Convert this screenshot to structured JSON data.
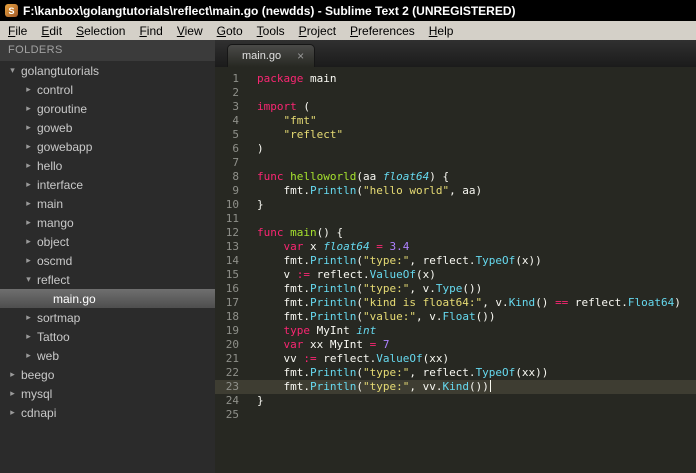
{
  "title_bar": {
    "title": "F:\\kanbox\\golangtutorials\\reflect\\main.go (newdds) - Sublime Text 2 (UNREGISTERED)",
    "app_icon_letter": "S"
  },
  "menu": {
    "items": [
      "File",
      "Edit",
      "Selection",
      "Find",
      "View",
      "Goto",
      "Tools",
      "Project",
      "Preferences",
      "Help"
    ]
  },
  "sidebar": {
    "header": "FOLDERS",
    "items": [
      {
        "label": "golangtutorials",
        "depth": 0,
        "kind": "folder",
        "expanded": true
      },
      {
        "label": "control",
        "depth": 1,
        "kind": "folder",
        "expanded": false
      },
      {
        "label": "goroutine",
        "depth": 1,
        "kind": "folder",
        "expanded": false
      },
      {
        "label": "goweb",
        "depth": 1,
        "kind": "folder",
        "expanded": false
      },
      {
        "label": "gowebapp",
        "depth": 1,
        "kind": "folder",
        "expanded": false
      },
      {
        "label": "hello",
        "depth": 1,
        "kind": "folder",
        "expanded": false
      },
      {
        "label": "interface",
        "depth": 1,
        "kind": "folder",
        "expanded": false
      },
      {
        "label": "main",
        "depth": 1,
        "kind": "folder",
        "expanded": false
      },
      {
        "label": "mango",
        "depth": 1,
        "kind": "folder",
        "expanded": false
      },
      {
        "label": "object",
        "depth": 1,
        "kind": "folder",
        "expanded": false
      },
      {
        "label": "oscmd",
        "depth": 1,
        "kind": "folder",
        "expanded": false
      },
      {
        "label": "reflect",
        "depth": 1,
        "kind": "folder",
        "expanded": true
      },
      {
        "label": "main.go",
        "depth": 2,
        "kind": "file",
        "selected": true
      },
      {
        "label": "sortmap",
        "depth": 1,
        "kind": "folder",
        "expanded": false
      },
      {
        "label": "Tattoo",
        "depth": 1,
        "kind": "folder",
        "expanded": false
      },
      {
        "label": "web",
        "depth": 1,
        "kind": "folder",
        "expanded": false
      },
      {
        "label": "beego",
        "depth": 0,
        "kind": "folder",
        "expanded": false
      },
      {
        "label": "mysql",
        "depth": 0,
        "kind": "folder",
        "expanded": false
      },
      {
        "label": "cdnapi",
        "depth": 0,
        "kind": "folder",
        "expanded": false
      }
    ]
  },
  "tab": {
    "label": "main.go",
    "close_glyph": "×"
  },
  "colors": {
    "editor_background": "#272822",
    "current_line": "#3e3d32",
    "keyword": "#f92672",
    "function_def": "#a6e22e",
    "function_call": "#66d9ef",
    "type": "#66d9ef",
    "string": "#e6db74",
    "number": "#ae81ff",
    "plain_text": "#f8f8f2",
    "line_number": "#8f908a"
  },
  "editor": {
    "lines": [
      {
        "n": 1,
        "s": [
          [
            "kw",
            "package"
          ],
          [
            "pl",
            " main"
          ]
        ]
      },
      {
        "n": 2,
        "s": []
      },
      {
        "n": 3,
        "s": [
          [
            "kw",
            "import"
          ],
          [
            "pl",
            " ("
          ]
        ]
      },
      {
        "n": 4,
        "s": [
          [
            "pl",
            "    "
          ],
          [
            "str",
            "\"fmt\""
          ]
        ]
      },
      {
        "n": 5,
        "s": [
          [
            "pl",
            "    "
          ],
          [
            "str",
            "\"reflect\""
          ]
        ]
      },
      {
        "n": 6,
        "s": [
          [
            "pl",
            ")"
          ]
        ]
      },
      {
        "n": 7,
        "s": []
      },
      {
        "n": 8,
        "s": [
          [
            "kw",
            "func"
          ],
          [
            "pl",
            " "
          ],
          [
            "fn",
            "helloworld"
          ],
          [
            "pl",
            "(aa "
          ],
          [
            "typ",
            "float64"
          ],
          [
            "pl",
            ") {"
          ]
        ]
      },
      {
        "n": 9,
        "s": [
          [
            "pl",
            "    fmt."
          ],
          [
            "call",
            "Println"
          ],
          [
            "pl",
            "("
          ],
          [
            "str",
            "\"hello world\""
          ],
          [
            "pl",
            ", aa)"
          ]
        ]
      },
      {
        "n": 10,
        "s": [
          [
            "pl",
            "}"
          ]
        ]
      },
      {
        "n": 11,
        "s": []
      },
      {
        "n": 12,
        "s": [
          [
            "kw",
            "func"
          ],
          [
            "pl",
            " "
          ],
          [
            "fn",
            "main"
          ],
          [
            "pl",
            "() {"
          ]
        ]
      },
      {
        "n": 13,
        "s": [
          [
            "pl",
            "    "
          ],
          [
            "kw",
            "var"
          ],
          [
            "pl",
            " x "
          ],
          [
            "typ",
            "float64"
          ],
          [
            "pl",
            " "
          ],
          [
            "kw",
            "="
          ],
          [
            "pl",
            " "
          ],
          [
            "num",
            "3.4"
          ]
        ]
      },
      {
        "n": 14,
        "s": [
          [
            "pl",
            "    fmt."
          ],
          [
            "call",
            "Println"
          ],
          [
            "pl",
            "("
          ],
          [
            "str",
            "\"type:\""
          ],
          [
            "pl",
            ", reflect."
          ],
          [
            "call",
            "TypeOf"
          ],
          [
            "pl",
            "(x))"
          ]
        ]
      },
      {
        "n": 15,
        "s": [
          [
            "pl",
            "    v "
          ],
          [
            "kw",
            ":="
          ],
          [
            "pl",
            " reflect."
          ],
          [
            "call",
            "ValueOf"
          ],
          [
            "pl",
            "(x)"
          ]
        ]
      },
      {
        "n": 16,
        "s": [
          [
            "pl",
            "    fmt."
          ],
          [
            "call",
            "Println"
          ],
          [
            "pl",
            "("
          ],
          [
            "str",
            "\"type:\""
          ],
          [
            "pl",
            ", v."
          ],
          [
            "call",
            "Type"
          ],
          [
            "pl",
            "())"
          ]
        ]
      },
      {
        "n": 17,
        "s": [
          [
            "pl",
            "    fmt."
          ],
          [
            "call",
            "Println"
          ],
          [
            "pl",
            "("
          ],
          [
            "str",
            "\"kind is float64:\""
          ],
          [
            "pl",
            ", v."
          ],
          [
            "call",
            "Kind"
          ],
          [
            "pl",
            "() "
          ],
          [
            "kw",
            "=="
          ],
          [
            "pl",
            " reflect."
          ],
          [
            "call",
            "Float64"
          ],
          [
            "pl",
            ")"
          ]
        ]
      },
      {
        "n": 18,
        "s": [
          [
            "pl",
            "    fmt."
          ],
          [
            "call",
            "Println"
          ],
          [
            "pl",
            "("
          ],
          [
            "str",
            "\"value:\""
          ],
          [
            "pl",
            ", v."
          ],
          [
            "call",
            "Float"
          ],
          [
            "pl",
            "())"
          ]
        ]
      },
      {
        "n": 19,
        "s": [
          [
            "pl",
            "    "
          ],
          [
            "kw",
            "type"
          ],
          [
            "pl",
            " MyInt "
          ],
          [
            "typ",
            "int"
          ]
        ]
      },
      {
        "n": 20,
        "s": [
          [
            "pl",
            "    "
          ],
          [
            "kw",
            "var"
          ],
          [
            "pl",
            " xx MyInt "
          ],
          [
            "kw",
            "="
          ],
          [
            "pl",
            " "
          ],
          [
            "num",
            "7"
          ]
        ]
      },
      {
        "n": 21,
        "s": [
          [
            "pl",
            "    vv "
          ],
          [
            "kw",
            ":="
          ],
          [
            "pl",
            " reflect."
          ],
          [
            "call",
            "ValueOf"
          ],
          [
            "pl",
            "(xx)"
          ]
        ]
      },
      {
        "n": 22,
        "s": [
          [
            "pl",
            "    fmt."
          ],
          [
            "call",
            "Println"
          ],
          [
            "pl",
            "("
          ],
          [
            "str",
            "\"type:\""
          ],
          [
            "pl",
            ", reflect."
          ],
          [
            "call",
            "TypeOf"
          ],
          [
            "pl",
            "(xx))"
          ]
        ]
      },
      {
        "n": 23,
        "s": [
          [
            "pl",
            "    fmt."
          ],
          [
            "call",
            "Println"
          ],
          [
            "pl",
            "("
          ],
          [
            "str",
            "\"type:\""
          ],
          [
            "pl",
            ", vv."
          ],
          [
            "call",
            "Kind"
          ],
          [
            "pl",
            "())"
          ]
        ],
        "current": true,
        "cursor": true
      },
      {
        "n": 24,
        "s": [
          [
            "pl",
            "}"
          ]
        ]
      },
      {
        "n": 25,
        "s": []
      }
    ]
  }
}
